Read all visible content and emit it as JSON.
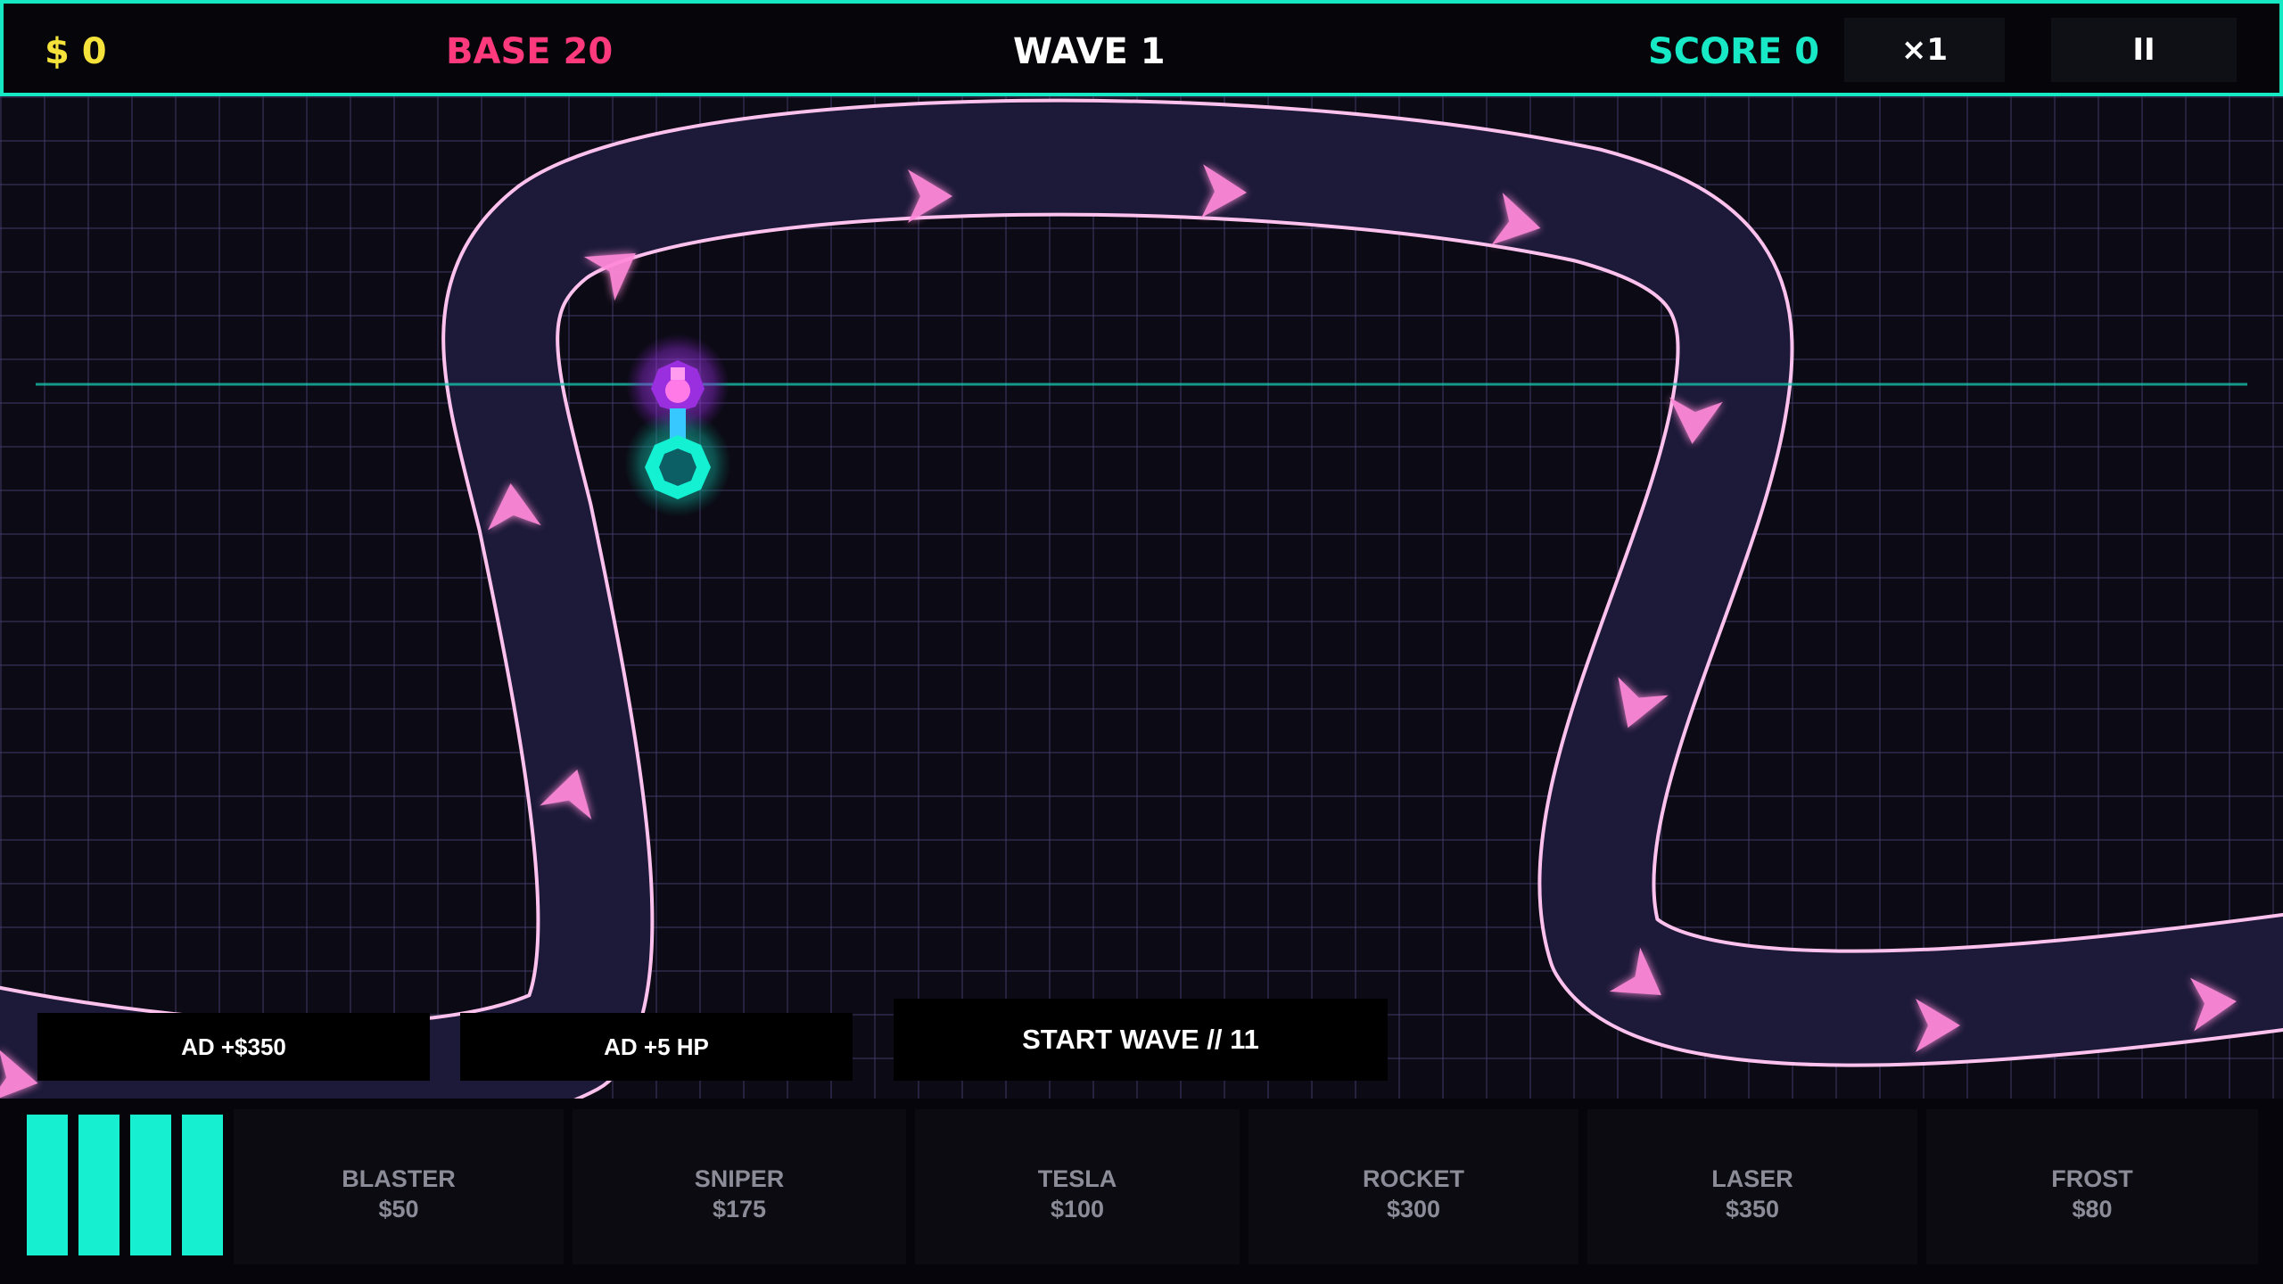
{
  "hud": {
    "money": "$ 0",
    "base": "BASE 20",
    "wave": "WAVE 1",
    "score": "SCORE 0",
    "speed_label": "×1",
    "pause_label": "II"
  },
  "actions": {
    "ad_money_label": "AD  +$350",
    "ad_hp_label": "AD  +5 HP",
    "start_wave_label": "START WAVE  //  11"
  },
  "shop": {
    "towers": [
      {
        "name": "BLASTER",
        "price": "$50"
      },
      {
        "name": "SNIPER",
        "price": "$175"
      },
      {
        "name": "TESLA",
        "price": "$100"
      },
      {
        "name": "ROCKET",
        "price": "$300"
      },
      {
        "name": "LASER",
        "price": "$350"
      },
      {
        "name": "FROST",
        "price": "$80"
      }
    ]
  },
  "colors": {
    "accent": "#16e8c4",
    "money": "#f5e23a",
    "base": "#ff3a7c",
    "path": "#1c1a38",
    "path_edge": "#ffc2ee",
    "arrow": "#ff8ad8"
  }
}
